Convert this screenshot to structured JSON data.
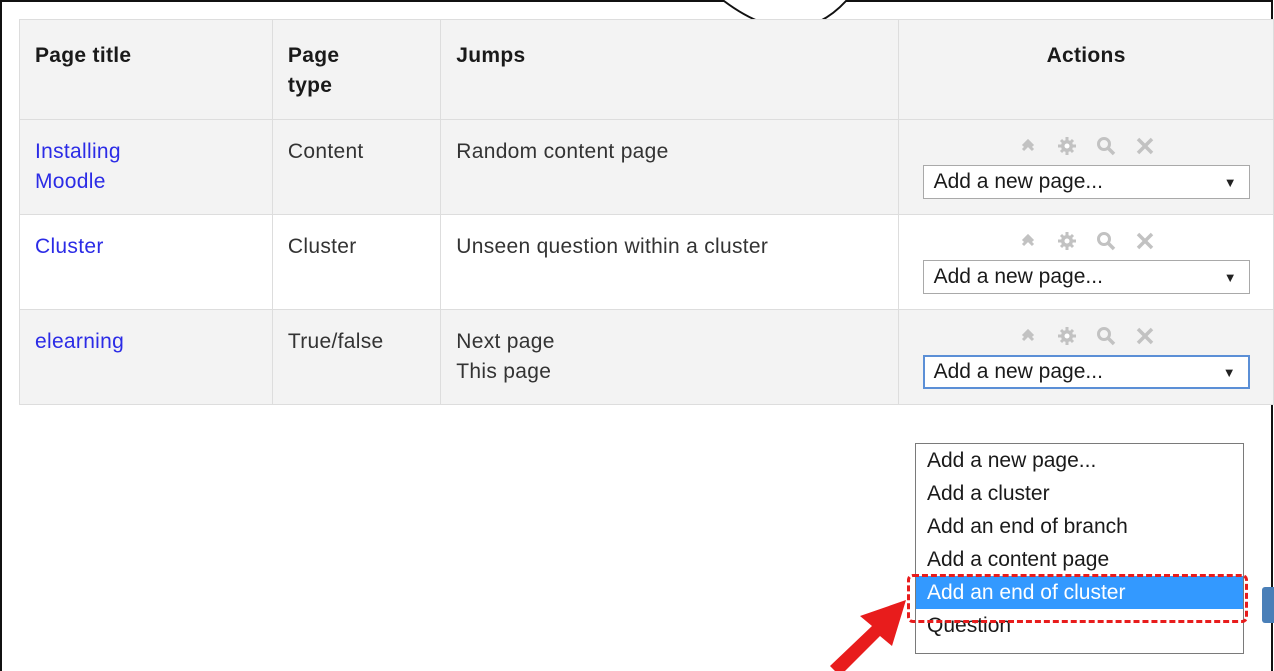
{
  "table": {
    "headers": {
      "page_title": "Page title",
      "page_type": "Page type",
      "jumps": "Jumps",
      "actions": "Actions"
    },
    "rows": [
      {
        "title": "Installing Moodle",
        "type": "Content",
        "jumps": [
          "Random content page"
        ],
        "select_value": "Add a new page..."
      },
      {
        "title": "Cluster",
        "type": "Cluster",
        "jumps": [
          "Unseen question within a cluster"
        ],
        "select_value": "Add a new page..."
      },
      {
        "title": "elearning",
        "type": "True/false",
        "jumps": [
          "Next page",
          "This page"
        ],
        "select_value": "Add a new page..."
      }
    ]
  },
  "action_icons": [
    "move-icon",
    "gear-icon",
    "search-icon",
    "close-icon"
  ],
  "dropdown": {
    "options": [
      "Add a new page...",
      "Add a cluster",
      "Add an end of branch",
      "Add a content page",
      "Add an end of cluster",
      "Question"
    ],
    "highlighted": "Add an end of cluster"
  },
  "colors": {
    "link": "#2b2be6",
    "option_highlight": "#3399ff",
    "annotation": "#e81c1c",
    "icon": "#c2c2c2"
  }
}
